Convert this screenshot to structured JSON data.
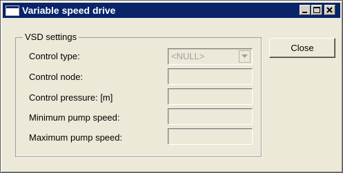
{
  "window": {
    "title": "Variable speed drive",
    "title_color": "#0a246a"
  },
  "controls": {
    "minimize_icon": "minimize-icon",
    "maximize_icon": "maximize-icon",
    "close_icon": "close-x-icon"
  },
  "group": {
    "legend": "VSD settings",
    "fields": [
      {
        "label": "Control type:",
        "type": "combo",
        "value": "<NULL>",
        "enabled": false
      },
      {
        "label": "Control node:",
        "type": "text",
        "value": "",
        "enabled": false
      },
      {
        "label": "Control pressure: [m]",
        "type": "text",
        "value": "",
        "enabled": false
      },
      {
        "label": "Minimum pump speed:",
        "type": "text",
        "value": "",
        "enabled": false
      },
      {
        "label": "Maximum pump speed:",
        "type": "text",
        "value": "",
        "enabled": false
      }
    ]
  },
  "buttons": {
    "close_label": "Close"
  }
}
